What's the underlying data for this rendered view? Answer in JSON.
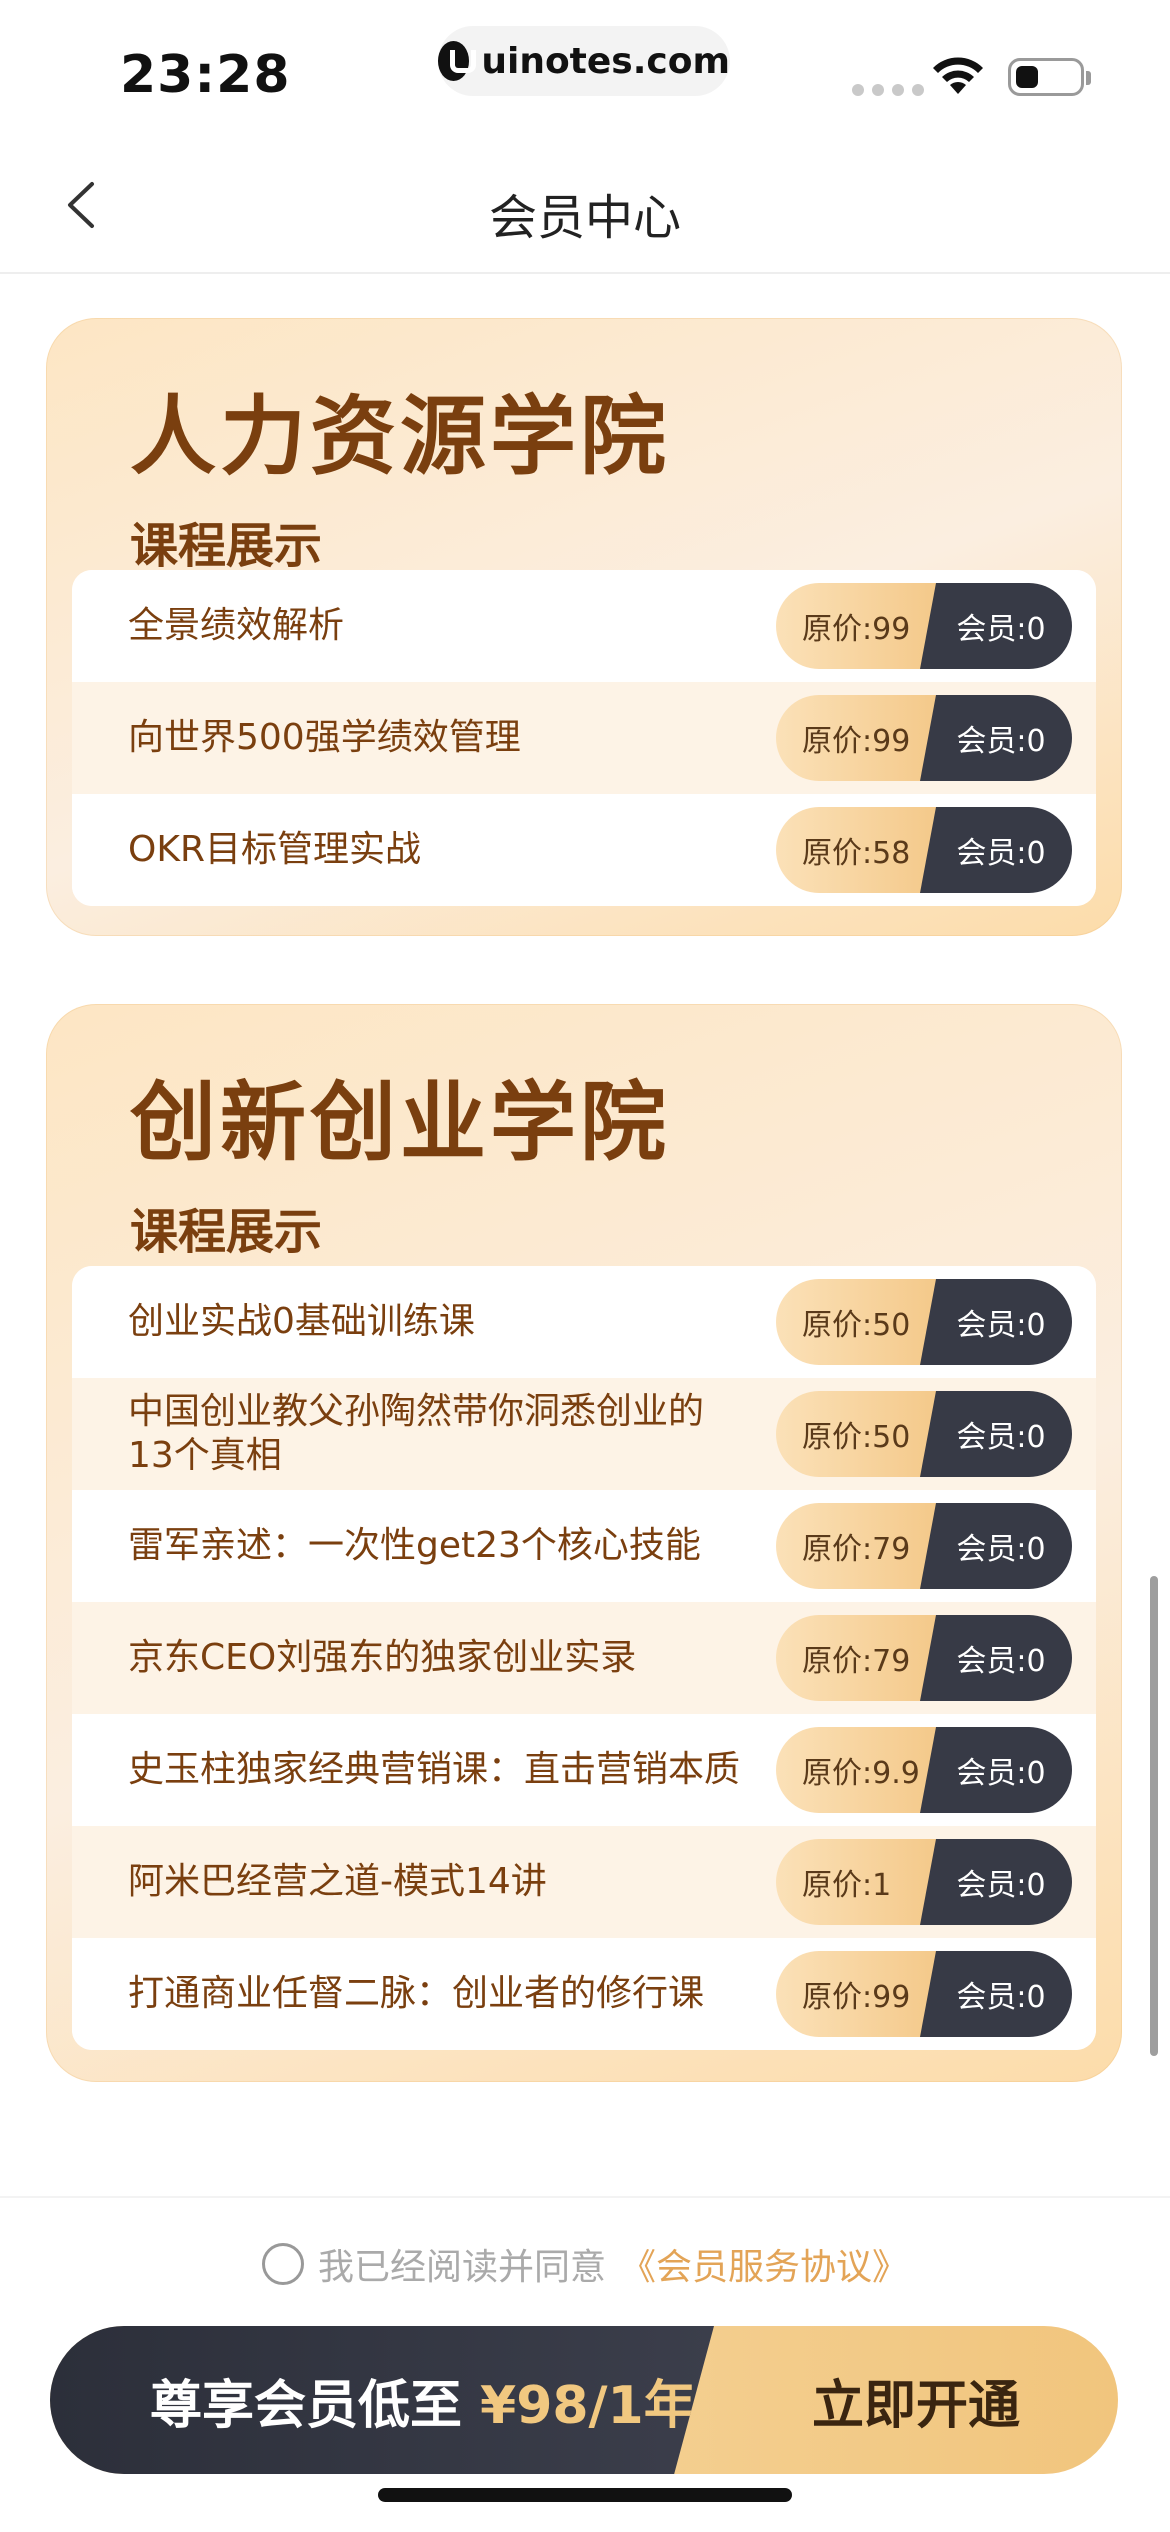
{
  "status_bar": {
    "time": "23:28",
    "url": "uinotes.com"
  },
  "nav": {
    "title": "会员中心"
  },
  "academies": [
    {
      "title": "人力资源学院",
      "subtitle": "课程展示",
      "courses": [
        {
          "name": "全景绩效解析",
          "original": "原价:99",
          "member": "会员:0"
        },
        {
          "name": "向世界500强学绩效管理",
          "original": "原价:99",
          "member": "会员:0"
        },
        {
          "name": "OKR目标管理实战",
          "original": "原价:58",
          "member": "会员:0"
        }
      ]
    },
    {
      "title": "创新创业学院",
      "subtitle": "课程展示",
      "courses": [
        {
          "name": "创业实战0基础训练课",
          "original": "原价:50",
          "member": "会员:0"
        },
        {
          "name": "中国创业教父孙陶然带你洞悉创业的13个真相",
          "original": "原价:50",
          "member": "会员:0"
        },
        {
          "name": "雷军亲述：一次性get23个核心技能",
          "original": "原价:79",
          "member": "会员:0"
        },
        {
          "name": "京东CEO刘强东的独家创业实录",
          "original": "原价:79",
          "member": "会员:0"
        },
        {
          "name": "史玉柱独家经典营销课：直击营销本质",
          "original": "原价:9.9",
          "member": "会员:0"
        },
        {
          "name": "阿米巴经营之道-模式14讲",
          "original": "原价:1",
          "member": "会员:0"
        },
        {
          "name": "打通商业任督二脉：创业者的修行课",
          "original": "原价:99",
          "member": "会员:0"
        }
      ]
    }
  ],
  "agreement": {
    "text": "我已经阅读并同意",
    "link": "《会员服务协议》"
  },
  "cta": {
    "left_text": "尊享会员低至",
    "price": "¥98/1年",
    "button": "立即开通"
  }
}
